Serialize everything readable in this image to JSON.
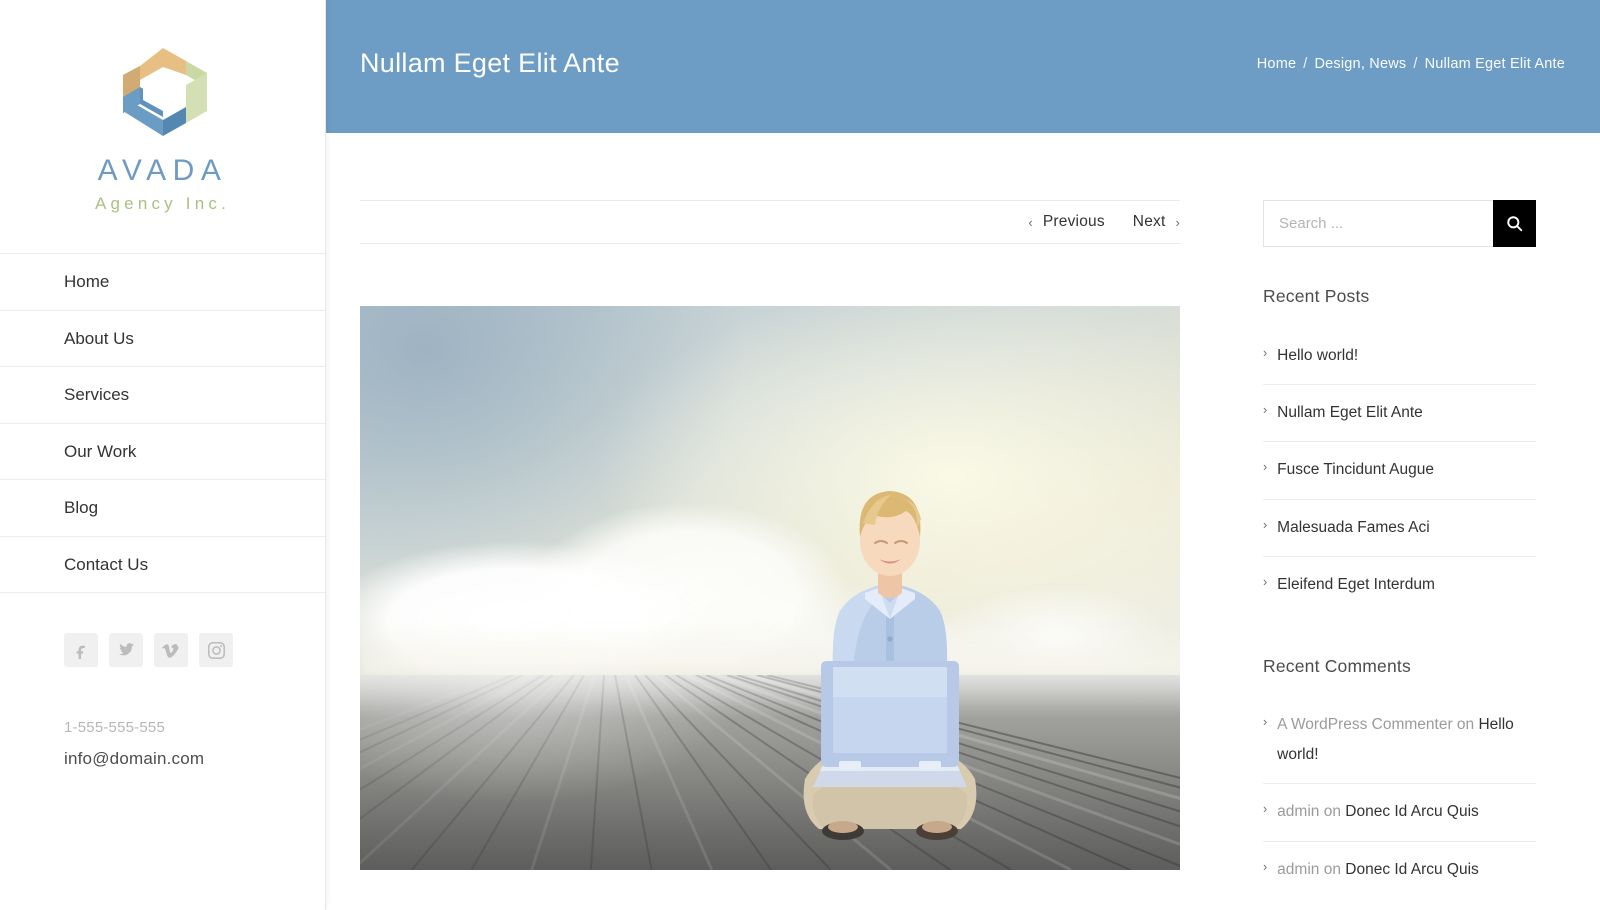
{
  "brand": {
    "logo_icon": "hexagon-ring-logo",
    "name": "AVADA",
    "tagline": "Agency Inc.",
    "name_color": "#6e9bc4",
    "tagline_color": "#a9c17f"
  },
  "sidebar": {
    "nav": [
      {
        "label": "Home"
      },
      {
        "label": "About Us"
      },
      {
        "label": "Services"
      },
      {
        "label": "Our Work"
      },
      {
        "label": "Blog"
      },
      {
        "label": "Contact Us"
      }
    ],
    "socials": [
      {
        "name": "facebook-icon",
        "label": "Facebook"
      },
      {
        "name": "twitter-icon",
        "label": "Twitter"
      },
      {
        "name": "vimeo-icon",
        "label": "Vimeo"
      },
      {
        "name": "instagram-icon",
        "label": "Instagram"
      }
    ],
    "contact": {
      "phone": "1-555-555-555",
      "email": "info@domain.com"
    }
  },
  "banner": {
    "title": "Nullam Eget Elit Ante",
    "background_color": "#6d9cc4",
    "breadcrumb": {
      "items": [
        "Home",
        "Design, News",
        "Nullam Eget Elit Ante"
      ],
      "separator": "/"
    }
  },
  "post": {
    "nav": {
      "previous_label": "Previous",
      "next_label": "Next",
      "prev_icon": "chevron-left-icon",
      "next_icon": "chevron-right-icon"
    },
    "featured_image_alt": "Woman sitting cross-legged on a wooden deck above the clouds using a laptop"
  },
  "aside": {
    "search": {
      "placeholder": "Search ...",
      "value": "",
      "button_icon": "search-icon",
      "button_color": "#000000"
    },
    "recent_posts": {
      "title": "Recent Posts",
      "items": [
        {
          "label": "Hello world!"
        },
        {
          "label": "Nullam Eget Elit Ante"
        },
        {
          "label": "Fusce Tincidunt Augue"
        },
        {
          "label": "Malesuada Fames Aci"
        },
        {
          "label": "Eleifend Eget Interdum"
        }
      ]
    },
    "recent_comments": {
      "title": "Recent Comments",
      "items": [
        {
          "author": "A WordPress Commenter",
          "on": "on",
          "post": "Hello world!"
        },
        {
          "author": "admin",
          "on": "on",
          "post": "Donec Id Arcu Quis"
        },
        {
          "author": "admin",
          "on": "on",
          "post": "Donec Id Arcu Quis"
        }
      ]
    },
    "bullet_icon": "chevron-right-icon"
  }
}
